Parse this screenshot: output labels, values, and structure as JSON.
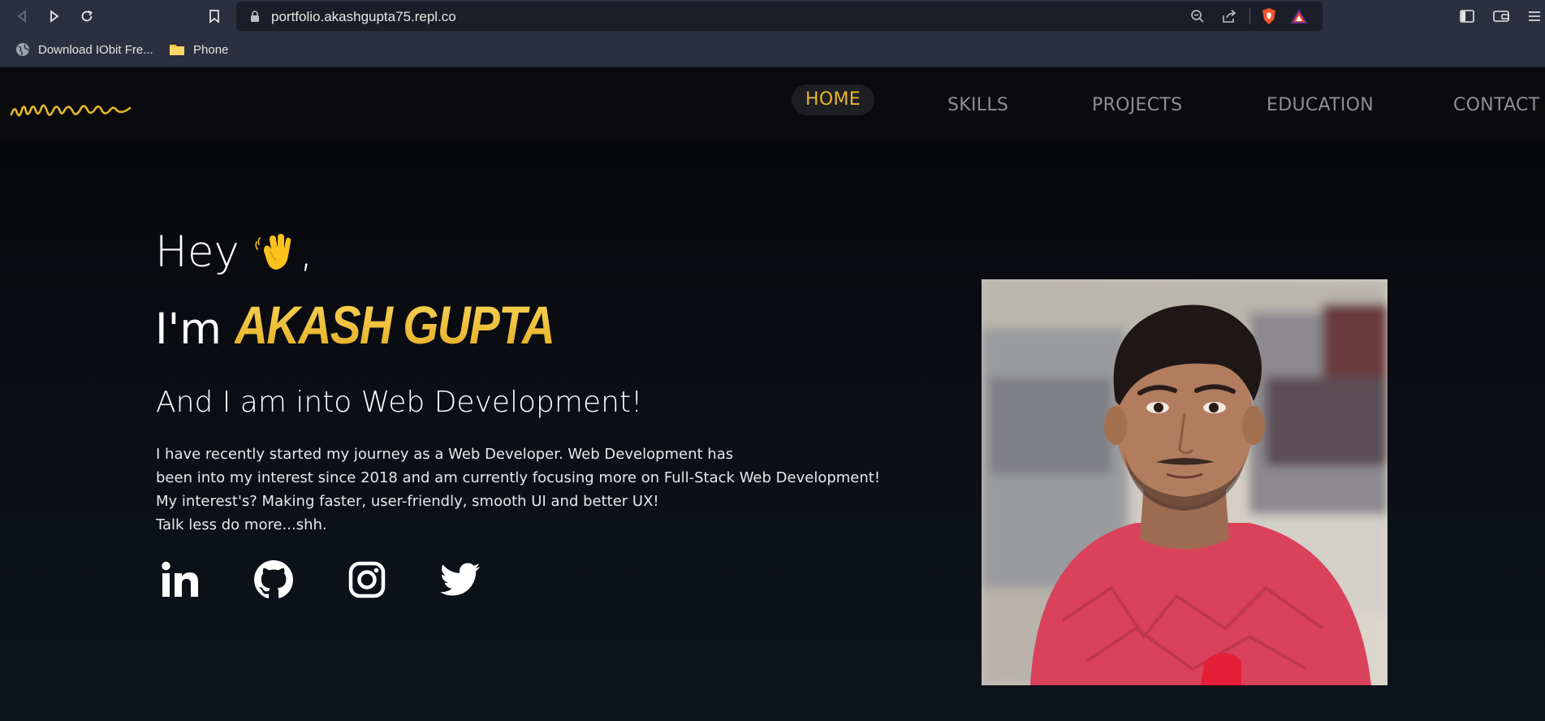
{
  "browser": {
    "url": "portfolio.akashgupta75.repl.co",
    "bookmarks": [
      {
        "label": "Download IObit Fre...",
        "icon": "globe-icon"
      },
      {
        "label": "Phone",
        "icon": "folder-icon"
      }
    ]
  },
  "nav": {
    "logo": "signature-logo",
    "items": [
      {
        "label": "HOME",
        "active": true
      },
      {
        "label": "SKILLS",
        "active": false
      },
      {
        "label": "PROJECTS",
        "active": false
      },
      {
        "label": "EDUCATION",
        "active": false
      },
      {
        "label": "CONTACT",
        "active": false
      }
    ]
  },
  "hero": {
    "greeting": "Hey",
    "greeting_suffix": ",",
    "intro": "I'm",
    "name": "AKASH GUPTA",
    "subtitle": "And I am into Web Development!",
    "bio_lines": [
      "I have recently started my journey as a Web Developer. Web Development has",
      "been into my interest since 2018 and am currently focusing more on Full-Stack Web Development!",
      "My interest's? Making faster, user-friendly, smooth UI and better UX!",
      "Talk less do more...shh."
    ],
    "social": [
      "linkedin-icon",
      "github-icon",
      "instagram-icon",
      "twitter-icon"
    ]
  },
  "colors": {
    "accent": "#e7b72c",
    "background": "#0b0e14",
    "chrome": "#2b2f3f"
  }
}
